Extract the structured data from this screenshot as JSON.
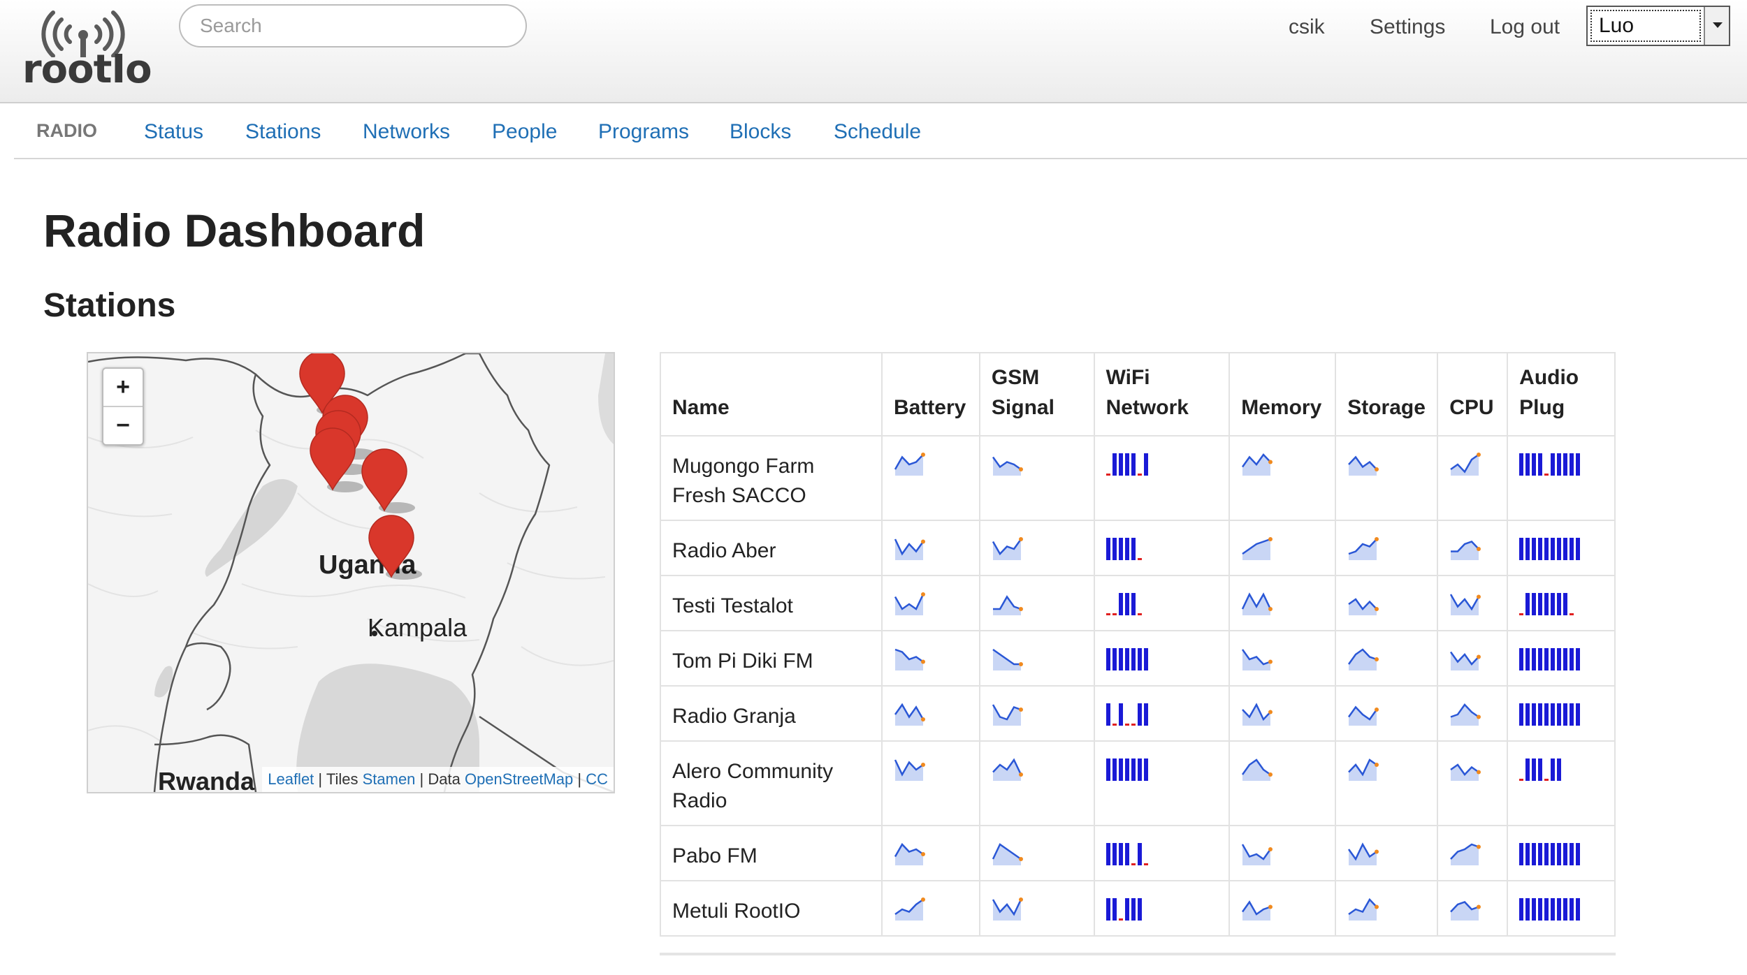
{
  "header": {
    "logo_text": "rootIo",
    "search_placeholder": "Search",
    "user_link": "csik",
    "settings_link": "Settings",
    "logout_link": "Log out",
    "language": "Luo"
  },
  "nav": {
    "brand": "RADIO",
    "items": [
      "Status",
      "Stations",
      "Networks",
      "People",
      "Programs",
      "Blocks",
      "Schedule"
    ]
  },
  "page": {
    "title": "Radio Dashboard",
    "section": "Stations"
  },
  "map": {
    "country_label": "Uganda",
    "city_label": "Kampala",
    "neighbor_label": "Rwanda",
    "zoom_in": "+",
    "zoom_out": "−",
    "attribution": {
      "leaflet": "Leaflet",
      "sep1": " | Tiles ",
      "stamen": "Stamen",
      "sep2": " | Data ",
      "osm": "OpenStreetMap",
      "sep3": " | ",
      "cc": "CC"
    },
    "marker_color": "#d9372b",
    "marker_count": 6
  },
  "table": {
    "headers": [
      "Name",
      "Battery",
      "GSM Signal",
      "WiFi Network",
      "Memory",
      "Storage",
      "CPU",
      "Audio Plug"
    ],
    "rows": [
      {
        "name": "Mugongo Farm Fresh SACCO",
        "sparks": [
          [
            2,
            7,
            4,
            5,
            8
          ],
          [
            7,
            3,
            5,
            4,
            2
          ],
          [
            0,
            1,
            1,
            1,
            1,
            0,
            1
          ],
          [
            3,
            7,
            4,
            8,
            5
          ],
          [
            4,
            7,
            3,
            5,
            2
          ],
          [
            2,
            4,
            1,
            6,
            8
          ],
          [
            1,
            1,
            1,
            1,
            0,
            1,
            1,
            1,
            1,
            1
          ]
        ]
      },
      {
        "name": "Radio Aber",
        "sparks": [
          [
            8,
            2,
            6,
            3,
            7
          ],
          [
            7,
            2,
            5,
            4,
            8
          ],
          [
            1,
            1,
            1,
            1,
            1,
            0
          ],
          [
            2,
            4,
            6,
            7,
            8
          ],
          [
            2,
            3,
            6,
            5,
            8
          ],
          [
            3,
            3,
            6,
            7,
            4
          ],
          [
            1,
            1,
            1,
            1,
            1,
            1,
            1,
            1,
            1,
            1
          ]
        ]
      },
      {
        "name": "Testi Testalot",
        "sparks": [
          [
            7,
            2,
            4,
            2,
            8
          ],
          [
            2,
            2,
            7,
            3,
            2
          ],
          [
            0,
            0,
            1,
            1,
            1,
            0
          ],
          [
            2,
            8,
            3,
            8,
            2
          ],
          [
            4,
            6,
            2,
            5,
            2
          ],
          [
            8,
            3,
            6,
            2,
            7
          ],
          [
            0,
            1,
            1,
            1,
            1,
            1,
            1,
            1,
            0
          ]
        ]
      },
      {
        "name": "Tom Pi Diki FM",
        "sparks": [
          [
            8,
            7,
            4,
            5,
            3
          ],
          [
            8,
            6,
            4,
            2,
            2
          ],
          [
            1,
            1,
            1,
            1,
            1,
            1,
            1
          ],
          [
            8,
            4,
            5,
            2,
            3
          ],
          [
            2,
            6,
            8,
            5,
            4
          ],
          [
            7,
            3,
            6,
            2,
            5
          ],
          [
            1,
            1,
            1,
            1,
            1,
            1,
            1,
            1,
            1,
            1
          ]
        ]
      },
      {
        "name": "Radio Granja",
        "sparks": [
          [
            4,
            8,
            3,
            7,
            2
          ],
          [
            8,
            3,
            2,
            7,
            6
          ],
          [
            1,
            0,
            1,
            0,
            0,
            1,
            1
          ],
          [
            6,
            3,
            8,
            2,
            5
          ],
          [
            3,
            7,
            4,
            2,
            6
          ],
          [
            3,
            4,
            8,
            5,
            3
          ],
          [
            1,
            1,
            1,
            1,
            1,
            1,
            1,
            1,
            1,
            1
          ]
        ]
      },
      {
        "name": "Alero Community Radio",
        "sparks": [
          [
            8,
            2,
            7,
            4,
            6
          ],
          [
            3,
            6,
            4,
            8,
            2
          ],
          [
            1,
            1,
            1,
            1,
            1,
            1,
            1
          ],
          [
            2,
            6,
            8,
            4,
            2
          ],
          [
            3,
            6,
            2,
            8,
            6
          ],
          [
            4,
            6,
            2,
            5,
            3
          ],
          [
            0,
            1,
            1,
            1,
            0,
            1,
            1
          ]
        ]
      },
      {
        "name": "Pabo FM",
        "sparks": [
          [
            3,
            8,
            5,
            6,
            4
          ],
          [
            2,
            8,
            6,
            4,
            2
          ],
          [
            1,
            1,
            1,
            1,
            0,
            1,
            0
          ],
          [
            8,
            3,
            4,
            2,
            6
          ],
          [
            6,
            2,
            8,
            3,
            5
          ],
          [
            2,
            5,
            6,
            8,
            7
          ],
          [
            1,
            1,
            1,
            1,
            1,
            1,
            1,
            1,
            1,
            1
          ]
        ]
      },
      {
        "name": "Metuli RootIO",
        "sparks": [
          [
            2,
            4,
            3,
            6,
            8
          ],
          [
            8,
            3,
            6,
            2,
            8
          ],
          [
            1,
            1,
            0,
            1,
            1,
            1
          ],
          [
            3,
            7,
            2,
            4,
            5
          ],
          [
            2,
            4,
            3,
            8,
            5
          ],
          [
            3,
            6,
            7,
            4,
            5
          ],
          [
            1,
            1,
            1,
            1,
            1,
            1,
            1,
            1,
            1,
            1
          ]
        ]
      }
    ],
    "colors": {
      "line": "#2a57d6",
      "fill": "#c9d6f5",
      "endpoint": "#f08a1f",
      "bar": "#1a1ad6",
      "bar_off": "#e02020"
    }
  }
}
